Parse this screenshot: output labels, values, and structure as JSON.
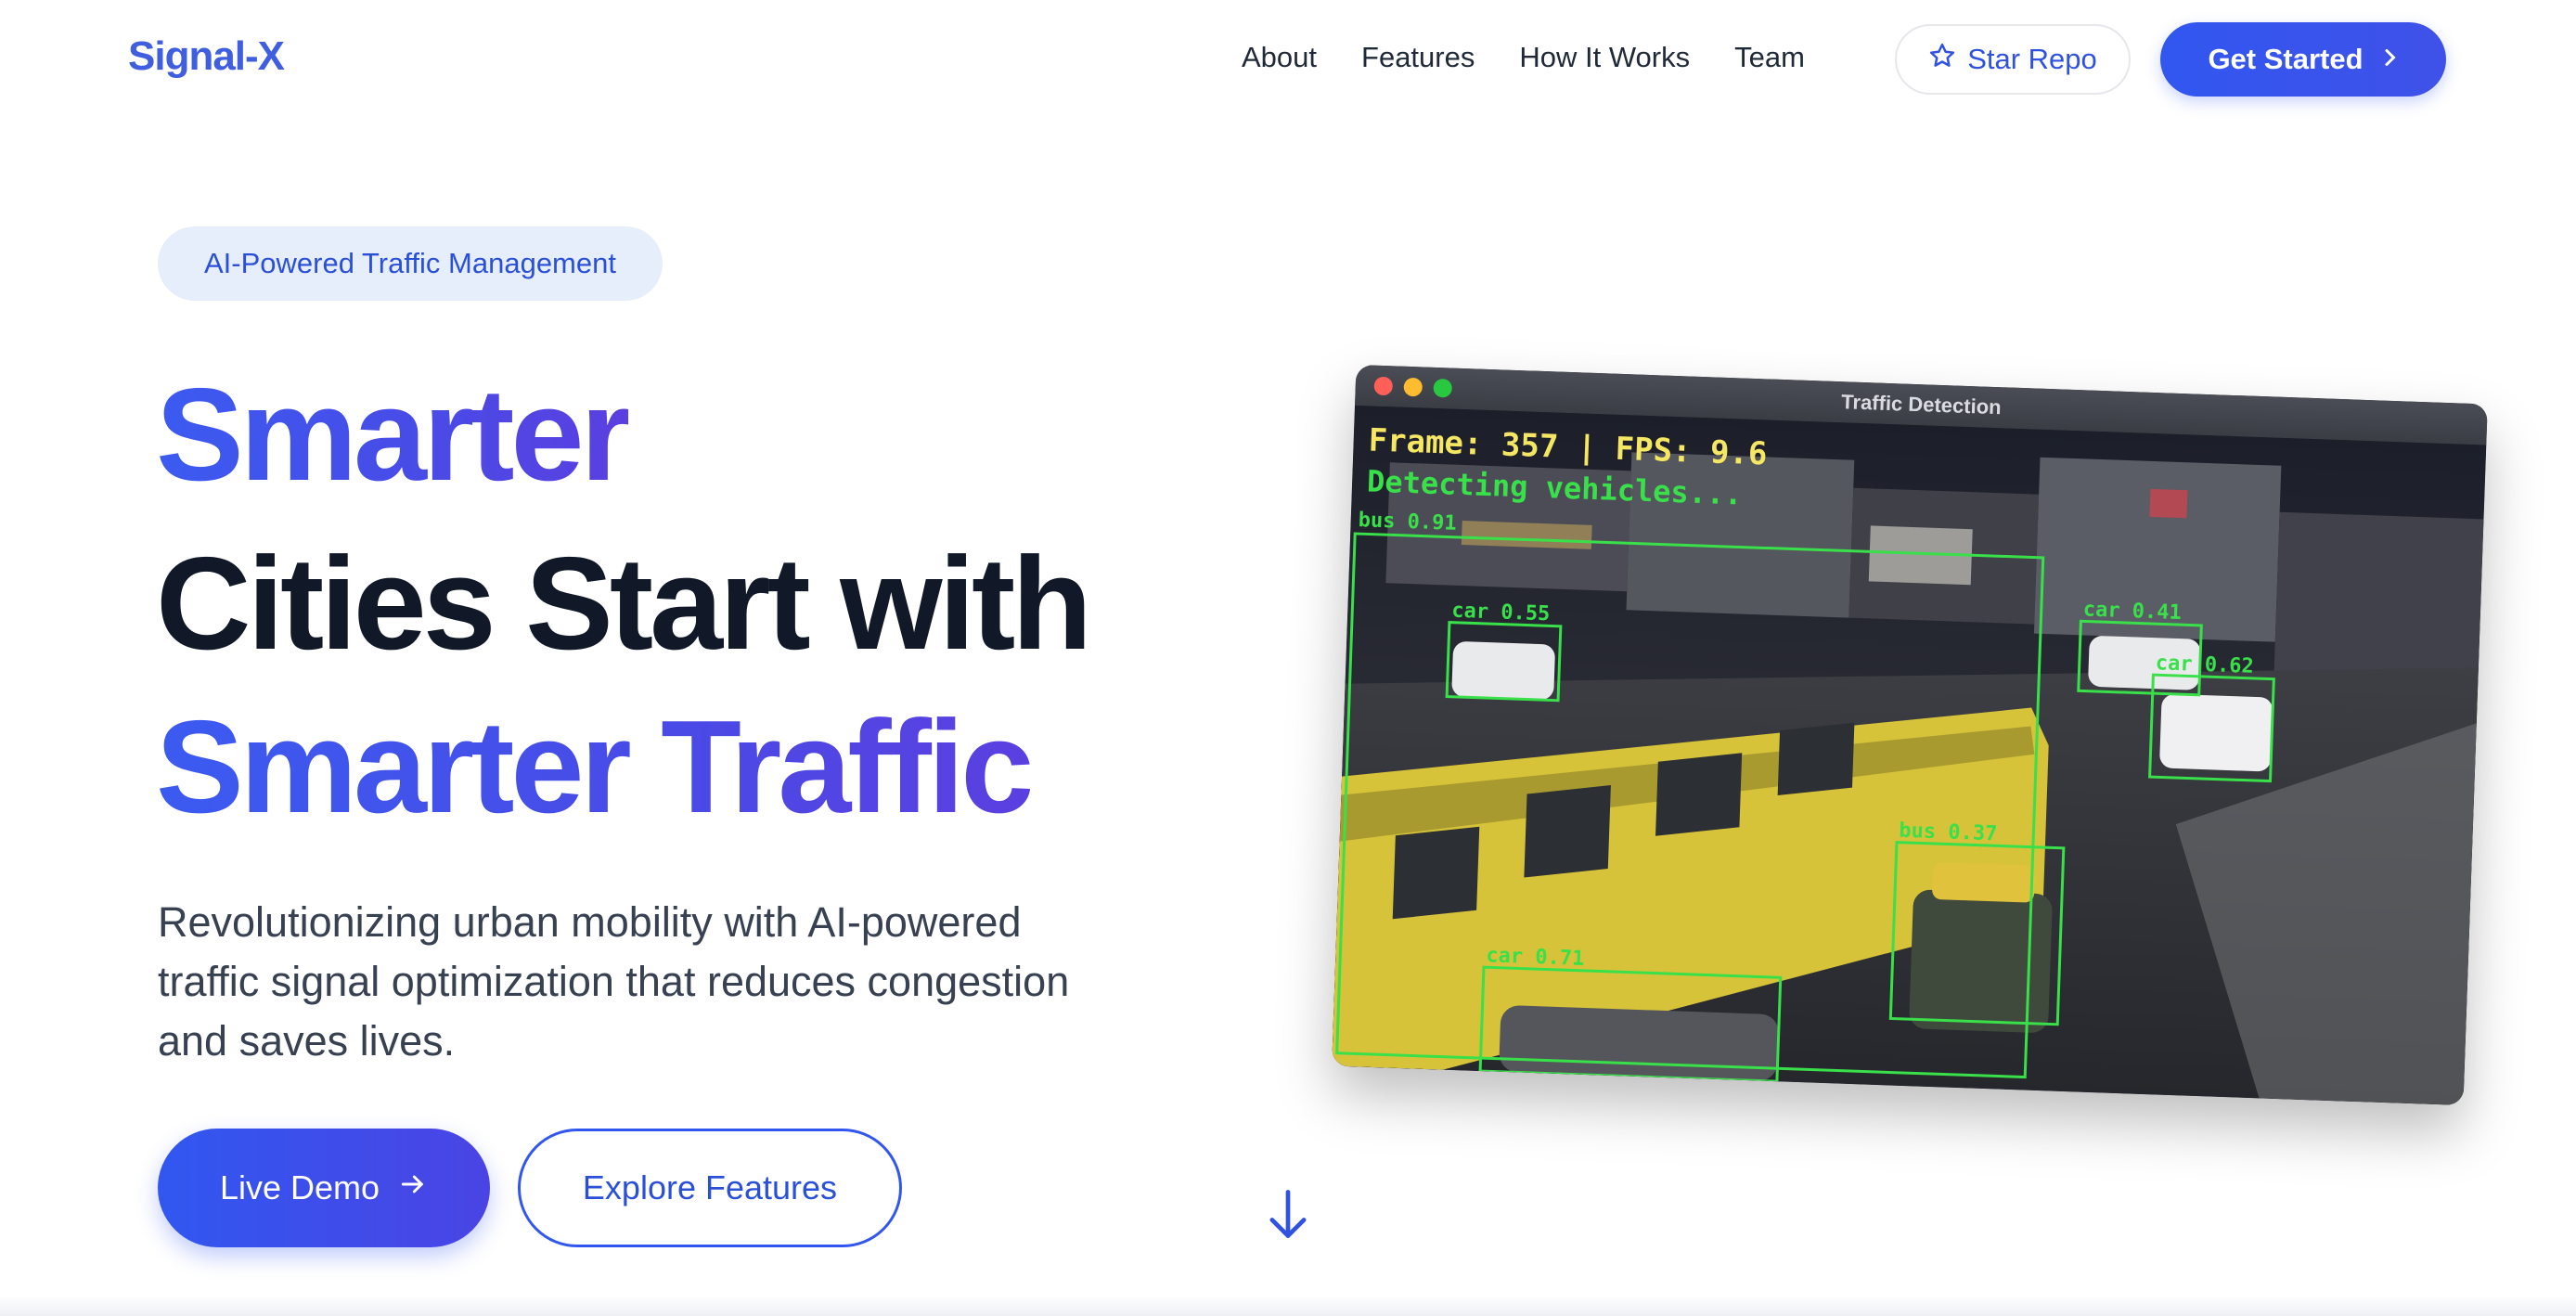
{
  "nav": {
    "logo": "Signal-X",
    "links": [
      "About",
      "Features",
      "How It Works",
      "Team"
    ],
    "star_label": "Star Repo",
    "cta_label": "Get Started"
  },
  "hero": {
    "badge": "AI-Powered Traffic Management",
    "headline_line1": "Smarter",
    "headline_line2": "Cities Start with",
    "headline_line3": "Smarter Traffic",
    "subtitle": "Revolutionizing urban mobility with AI-powered traffic signal optimization that reduces congestion and saves lives.",
    "primary_button": "Live Demo",
    "secondary_button": "Explore Features"
  },
  "demo_window": {
    "title": "Traffic Detection",
    "frame_text": "Frame: 357 | FPS: 9.6",
    "status_text": "Detecting vehicles...",
    "detections": [
      {
        "label": "bus 0.91"
      },
      {
        "label": "car 0.55"
      },
      {
        "label": "car 0.41"
      },
      {
        "label": "car 0.62"
      },
      {
        "label": "bus 0.37"
      },
      {
        "label": "car 0.71"
      }
    ]
  },
  "colors": {
    "brand_blue": "#3157f0",
    "brand_purple": "#5b3fe0",
    "badge_bg": "#e6edfb",
    "detection_green": "#39e04a",
    "overlay_yellow": "#f5e663"
  },
  "icons": {
    "star": "star-icon",
    "cta_chevron": "chevron-right-icon",
    "demo_arrow": "arrow-right-icon",
    "scroll": "arrow-down-icon"
  }
}
